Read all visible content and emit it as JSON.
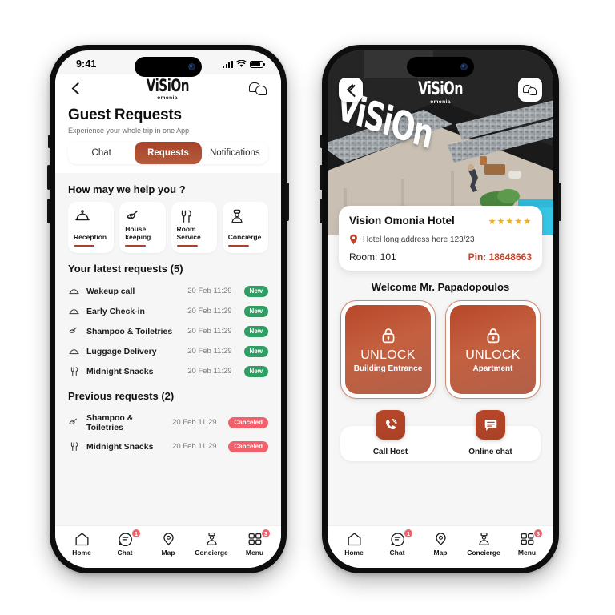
{
  "colors": {
    "brand": "#a8432a",
    "brand_light": "#c4603f",
    "new_badge": "#2e9e62",
    "cancel_badge": "#f2606b",
    "star": "#f2b01e",
    "pin_text": "#c0432a",
    "screen_bg": "#f6f6f6"
  },
  "left_phone": {
    "status": {
      "time": "9:41",
      "signal_icon": "signal-bars-icon",
      "wifi_icon": "wifi-icon",
      "battery_icon": "battery-icon"
    },
    "nav": {
      "back_icon": "chevron-left-icon",
      "logo_word": "ViSiOn",
      "logo_sub": "omonia",
      "chat_icon": "chat-bubbles-icon"
    },
    "title": "Guest Requests",
    "subtitle": "Experience your whole trip in one App",
    "tabs": [
      {
        "label": "Chat",
        "active": false
      },
      {
        "label": "Requests",
        "active": true
      },
      {
        "label": "Notifications",
        "active": false
      }
    ],
    "help_heading": "How may we help you ?",
    "services": [
      {
        "label": "Reception",
        "icon": "service-bell-icon"
      },
      {
        "label": "House keeping",
        "icon": "broom-icon"
      },
      {
        "label": "Room Service",
        "icon": "fork-knife-icon"
      },
      {
        "label": "Concierge",
        "icon": "concierge-person-icon"
      }
    ],
    "latest_heading": "Your latest requests (5)",
    "latest_requests": [
      {
        "icon": "service-bell-icon",
        "name": "Wakeup call",
        "time": "20 Feb 11:29",
        "status": "New"
      },
      {
        "icon": "service-bell-icon",
        "name": "Early Check-in",
        "time": "20 Feb 11:29",
        "status": "New"
      },
      {
        "icon": "broom-icon",
        "name": "Shampoo & Toiletries",
        "time": "20 Feb 11:29",
        "status": "New"
      },
      {
        "icon": "service-bell-icon",
        "name": "Luggage Delivery",
        "time": "20 Feb 11:29",
        "status": "New"
      },
      {
        "icon": "fork-knife-icon",
        "name": "Midnight Snacks",
        "time": "20 Feb 11:29",
        "status": "New"
      }
    ],
    "previous_heading": "Previous requests (2)",
    "previous_requests": [
      {
        "icon": "broom-icon",
        "name": "Shampoo & Toiletries",
        "time": "20 Feb 11:29",
        "status": "Canceled"
      },
      {
        "icon": "fork-knife-icon",
        "name": "Midnight Snacks",
        "time": "20 Feb 11:29",
        "status": "Canceled"
      }
    ],
    "tabbar": [
      {
        "label": "Home",
        "icon": "home-icon",
        "badge": ""
      },
      {
        "label": "Chat",
        "icon": "chat-icon",
        "badge": "1"
      },
      {
        "label": "Map",
        "icon": "map-pin-icon",
        "badge": ""
      },
      {
        "label": "Concierge",
        "icon": "concierge-person-icon",
        "badge": ""
      },
      {
        "label": "Menu",
        "icon": "grid-menu-icon",
        "badge": "3"
      }
    ]
  },
  "right_phone": {
    "hero": {
      "back_icon": "chevron-left-icon",
      "chat_icon": "chat-bubbles-icon",
      "logo_word": "ViSiOn",
      "logo_sub": "omonia",
      "sign_word": "ViSiOn"
    },
    "info": {
      "hotel_name": "Vision Omonia Hotel",
      "stars": "★★★★★",
      "pin_icon": "location-pin-icon",
      "address": "Hotel long address here 123/23",
      "room": "Room: 101",
      "pin": "Pin: 18648663"
    },
    "welcome": "Welcome Mr. Papadopoulos",
    "unlocks": [
      {
        "icon": "lock-icon",
        "action": "UNLOCK",
        "target": "Building Entrance"
      },
      {
        "icon": "lock-icon",
        "action": "UNLOCK",
        "target": "Apartment"
      }
    ],
    "contacts": [
      {
        "label": "Call Host",
        "icon": "phone-ring-icon"
      },
      {
        "label": "Online chat",
        "icon": "chat-message-icon"
      }
    ],
    "tabbar": [
      {
        "label": "Home",
        "icon": "home-icon",
        "badge": ""
      },
      {
        "label": "Chat",
        "icon": "chat-icon",
        "badge": "1"
      },
      {
        "label": "Map",
        "icon": "map-pin-icon",
        "badge": ""
      },
      {
        "label": "Concierge",
        "icon": "concierge-person-icon",
        "badge": ""
      },
      {
        "label": "Menu",
        "icon": "grid-menu-icon",
        "badge": "3"
      }
    ]
  }
}
